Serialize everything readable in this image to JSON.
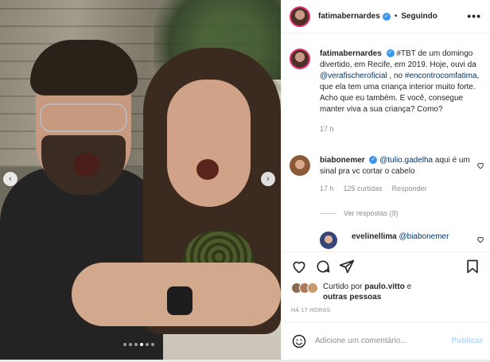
{
  "post": {
    "username": "fatimabernardes",
    "separator": "•",
    "follow_status": "Seguindo",
    "more": "•••",
    "caption": {
      "username": "fatimabernardes",
      "part1": "#TBT de um domingo divertido, em Recife, em 2019. Hoje, ouvi da ",
      "mention": "@verafischeroficial",
      "part2": " , no ",
      "hashtag": "#encontrocomfatima",
      "part3": ", que ela tem uma criança interior muito forte. Acho que eu também. E você, consegue manter viva a sua criança? Como?",
      "time": "17 h"
    }
  },
  "comment": {
    "username": "biabonemer",
    "mention": "@tulio.gadelha",
    "text": " aqui é um sinal pra vc cortar o cabelo",
    "time": "17 h",
    "likes": "125 curtidas",
    "reply": "Responder",
    "view_replies": "Ver respostas (9)"
  },
  "reply": {
    "username": "evelinellima",
    "mention": "@biabonemer"
  },
  "likes": {
    "prefix": "Curtido por ",
    "user": "paulo.vitto",
    "connector": " e",
    "others": "outras pessoas"
  },
  "timestamp": "HÁ 17 HORAS",
  "add_comment": {
    "placeholder": "Adicione um comentário...",
    "publish": "Publicar"
  },
  "carousel": {
    "prev": "‹",
    "next": "›",
    "slides": 6,
    "active_index": 3
  },
  "colors": {
    "link": "#00376b",
    "verified": "#3897f0",
    "muted": "#8e8e8e",
    "publish_disabled": "#b3dbff"
  }
}
